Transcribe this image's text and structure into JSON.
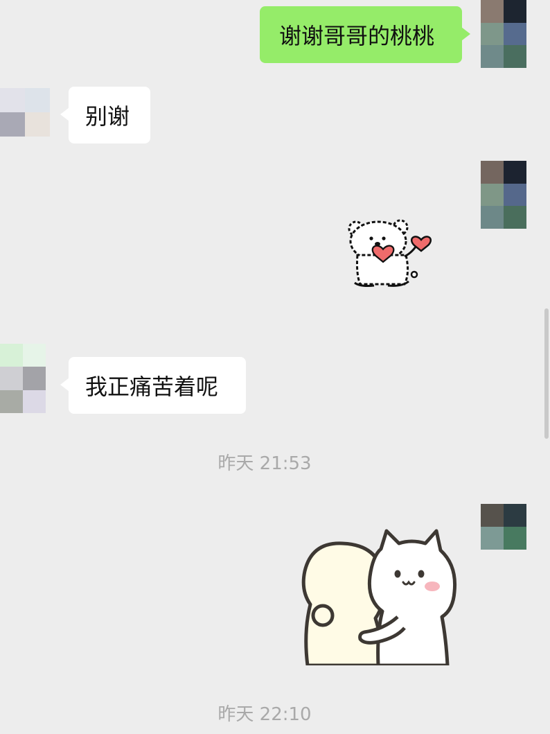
{
  "messages": [
    {
      "id": "m1",
      "sender": "me",
      "type": "text",
      "text": "谢谢哥哥的桃桃"
    },
    {
      "id": "m2",
      "sender": "other",
      "type": "text",
      "text": "别谢"
    },
    {
      "id": "m3",
      "sender": "me",
      "type": "sticker",
      "sticker": "bear-holding-hearts"
    },
    {
      "id": "m4",
      "sender": "other",
      "type": "text",
      "text": "我正痛苦着呢"
    },
    {
      "id": "m5",
      "sender": "me",
      "type": "sticker",
      "sticker": "cat-hugging-person"
    }
  ],
  "timestamps": [
    "昨天 21:53",
    "昨天 22:10"
  ],
  "colors": {
    "background": "#ededed",
    "my_bubble": "#95ec69",
    "other_bubble": "#ffffff",
    "timestamp_text": "#a9a9a9",
    "heart": "#ef6b6b"
  }
}
